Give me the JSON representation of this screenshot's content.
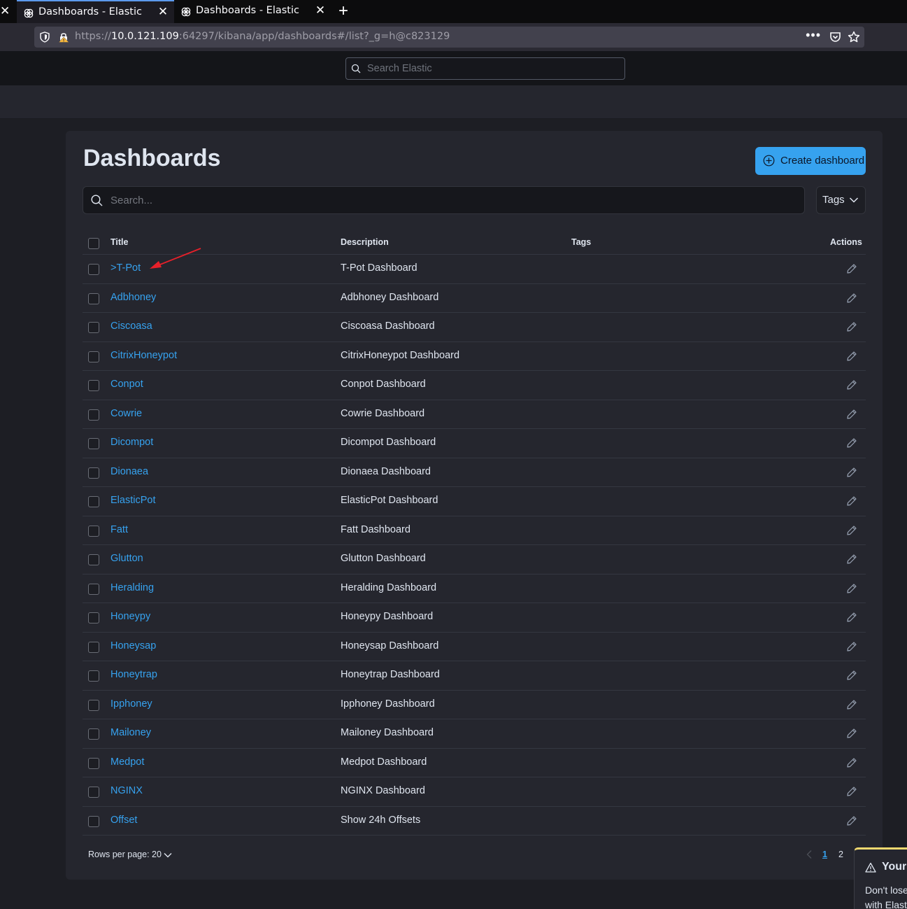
{
  "browser": {
    "tabs": [
      {
        "title": "Dashboards - Elastic",
        "active": true
      },
      {
        "title": "Dashboards - Elastic",
        "active": false
      }
    ],
    "url_prefix": "https://",
    "url_host": "10.0.121.109",
    "url_rest": ":64297/kibana/app/dashboards#/list?_g=h@c823129"
  },
  "header": {
    "search_placeholder": "Search Elastic"
  },
  "page": {
    "title": "Dashboards",
    "create_button": "Create dashboard",
    "search_placeholder": "Search...",
    "tags_filter": "Tags"
  },
  "table": {
    "columns": {
      "title": "Title",
      "description": "Description",
      "tags": "Tags",
      "actions": "Actions"
    },
    "rows": [
      {
        "title": ">T-Pot",
        "description": "T-Pot Dashboard"
      },
      {
        "title": "Adbhoney",
        "description": "Adbhoney Dashboard"
      },
      {
        "title": "Ciscoasa",
        "description": "Ciscoasa Dashboard"
      },
      {
        "title": "CitrixHoneypot",
        "description": "CitrixHoneypot Dashboard"
      },
      {
        "title": "Conpot",
        "description": "Conpot Dashboard"
      },
      {
        "title": "Cowrie",
        "description": "Cowrie Dashboard"
      },
      {
        "title": "Dicompot",
        "description": "Dicompot Dashboard"
      },
      {
        "title": "Dionaea",
        "description": "Dionaea Dashboard"
      },
      {
        "title": "ElasticPot",
        "description": "ElasticPot Dashboard"
      },
      {
        "title": "Fatt",
        "description": "Fatt Dashboard"
      },
      {
        "title": "Glutton",
        "description": "Glutton Dashboard"
      },
      {
        "title": "Heralding",
        "description": "Heralding Dashboard"
      },
      {
        "title": "Honeypy",
        "description": "Honeypy Dashboard"
      },
      {
        "title": "Honeysap",
        "description": "Honeysap Dashboard"
      },
      {
        "title": "Honeytrap",
        "description": "Honeytrap Dashboard"
      },
      {
        "title": "Ipphoney",
        "description": "Ipphoney Dashboard"
      },
      {
        "title": "Mailoney",
        "description": "Mailoney Dashboard"
      },
      {
        "title": "Medpot",
        "description": "Medpot Dashboard"
      },
      {
        "title": "NGINX",
        "description": "NGINX Dashboard"
      },
      {
        "title": "Offset",
        "description": "Show 24h Offsets"
      }
    ]
  },
  "pagination": {
    "rows_per_page": "Rows per page: 20",
    "pages": [
      "1",
      "2"
    ],
    "current": "1"
  },
  "toast": {
    "title": "Your",
    "line1": "Don't lose",
    "line2": "with Elast"
  },
  "colors": {
    "accent": "#36a2ef",
    "annotation_arrow": "#e8202a",
    "toast_warning": "#f1d86f"
  },
  "icons": {
    "tab_favicon": "elastic-logo-icon",
    "row_action": "pencil-edit-icon",
    "create": "plus-circle-icon",
    "search": "search-icon",
    "toast": "warning-icon"
  }
}
